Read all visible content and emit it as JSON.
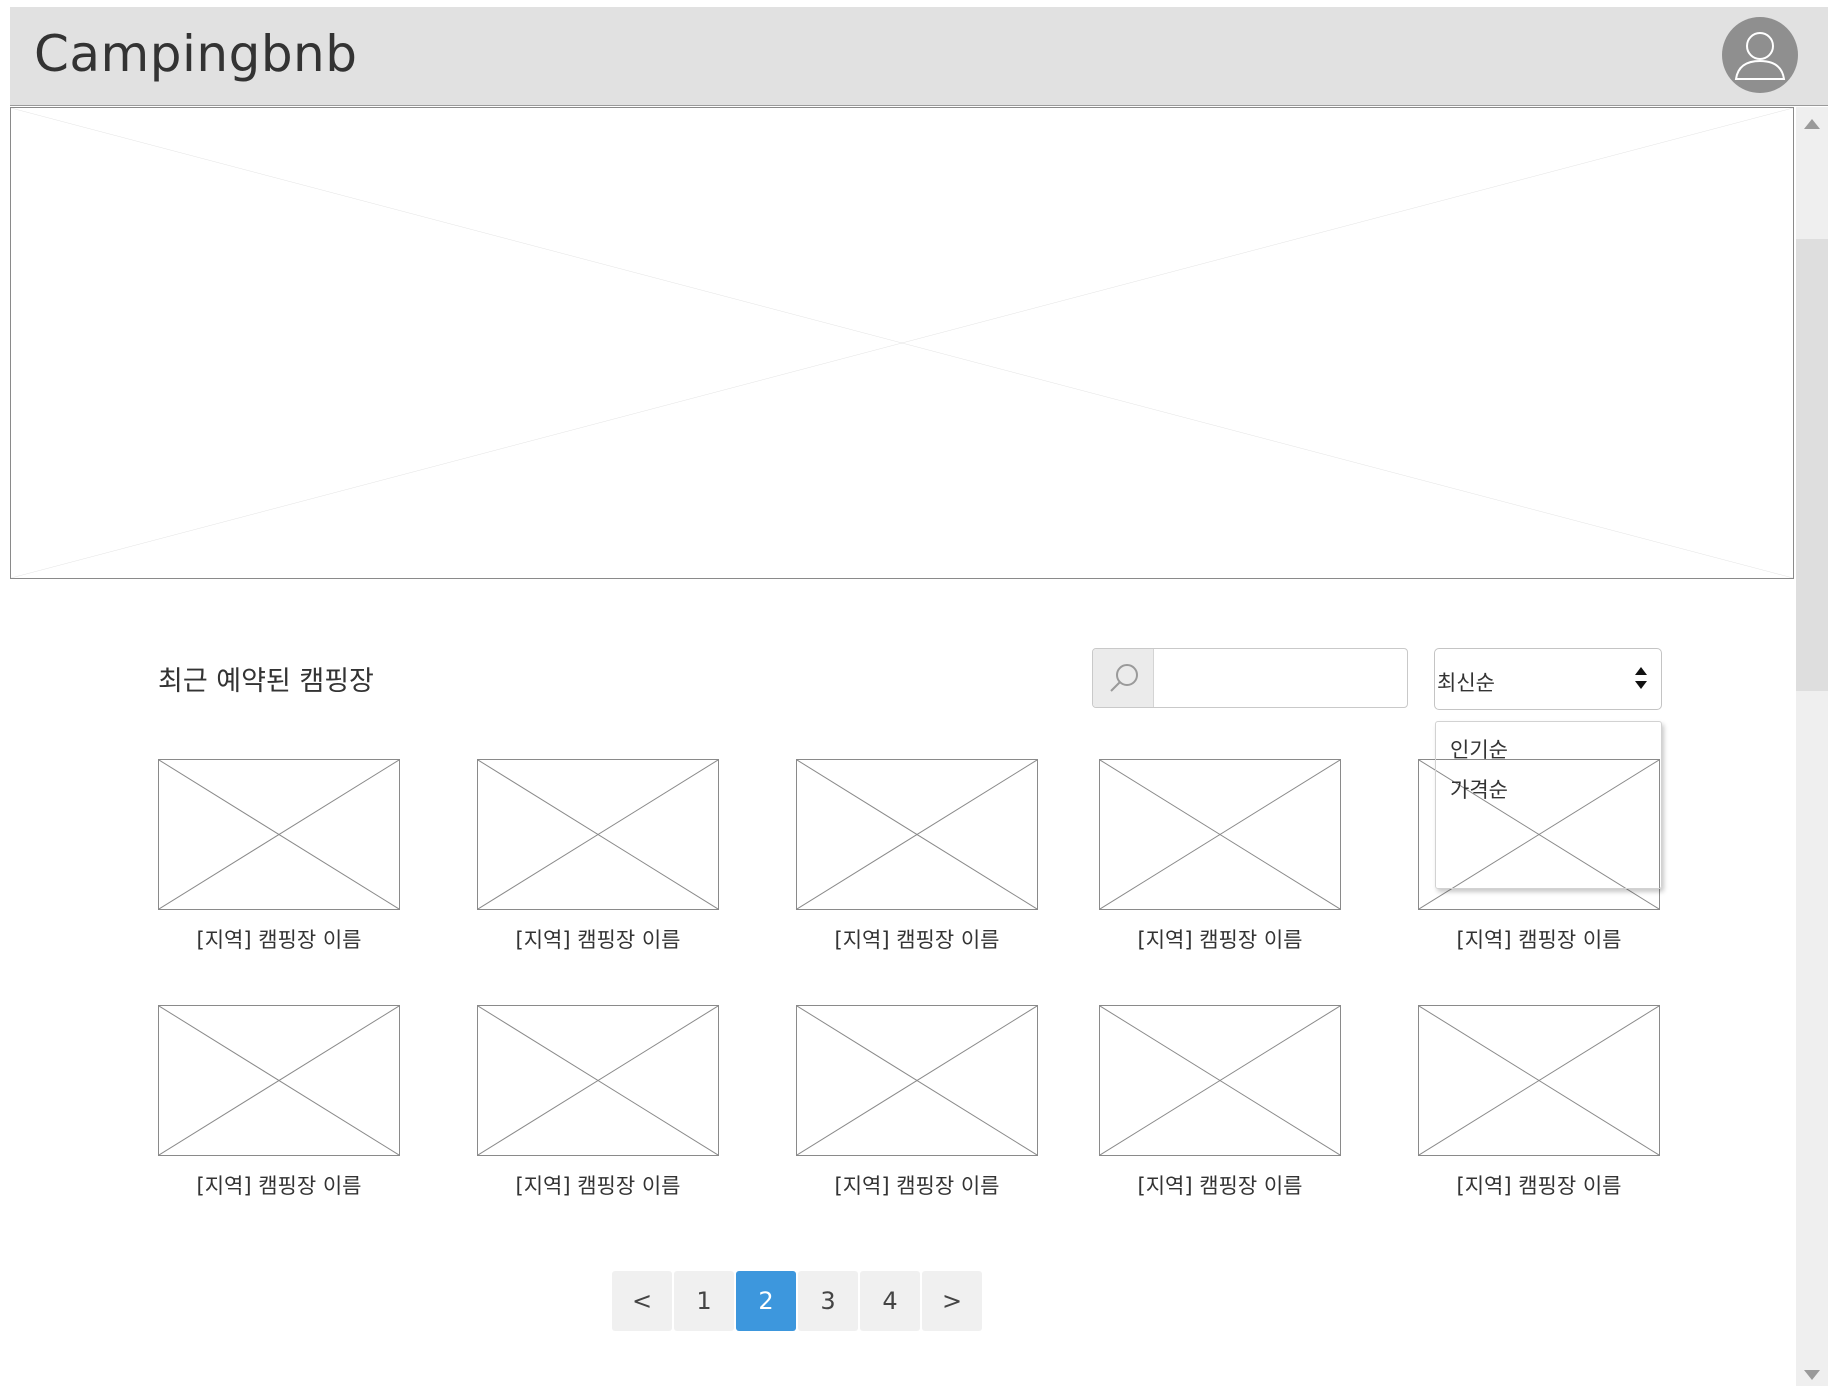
{
  "header": {
    "logo": "Campingbnb",
    "avatar_icon": "user-avatar-icon"
  },
  "section": {
    "title": "최근 예약된 캠핑장"
  },
  "search": {
    "icon": "search-icon",
    "value": "",
    "placeholder": ""
  },
  "sort": {
    "selected": "최신순",
    "options": [
      "인기순",
      "가격순"
    ]
  },
  "campsites": [
    {
      "label": "[지역] 캠핑장 이름"
    },
    {
      "label": "[지역] 캠핑장 이름"
    },
    {
      "label": "[지역] 캠핑장 이름"
    },
    {
      "label": "[지역] 캠핑장 이름"
    },
    {
      "label": "[지역] 캠핑장 이름"
    },
    {
      "label": "[지역] 캠핑장 이름"
    },
    {
      "label": "[지역] 캠핑장 이름"
    },
    {
      "label": "[지역] 캠핑장 이름"
    },
    {
      "label": "[지역] 캠핑장 이름"
    },
    {
      "label": "[지역] 캠핑장 이름"
    }
  ],
  "pagination": {
    "prev": "<",
    "pages": [
      "1",
      "2",
      "3",
      "4"
    ],
    "current": "2",
    "next": ">"
  },
  "colors": {
    "header_bg": "#e1e1e1",
    "accent": "#3d97dd"
  }
}
